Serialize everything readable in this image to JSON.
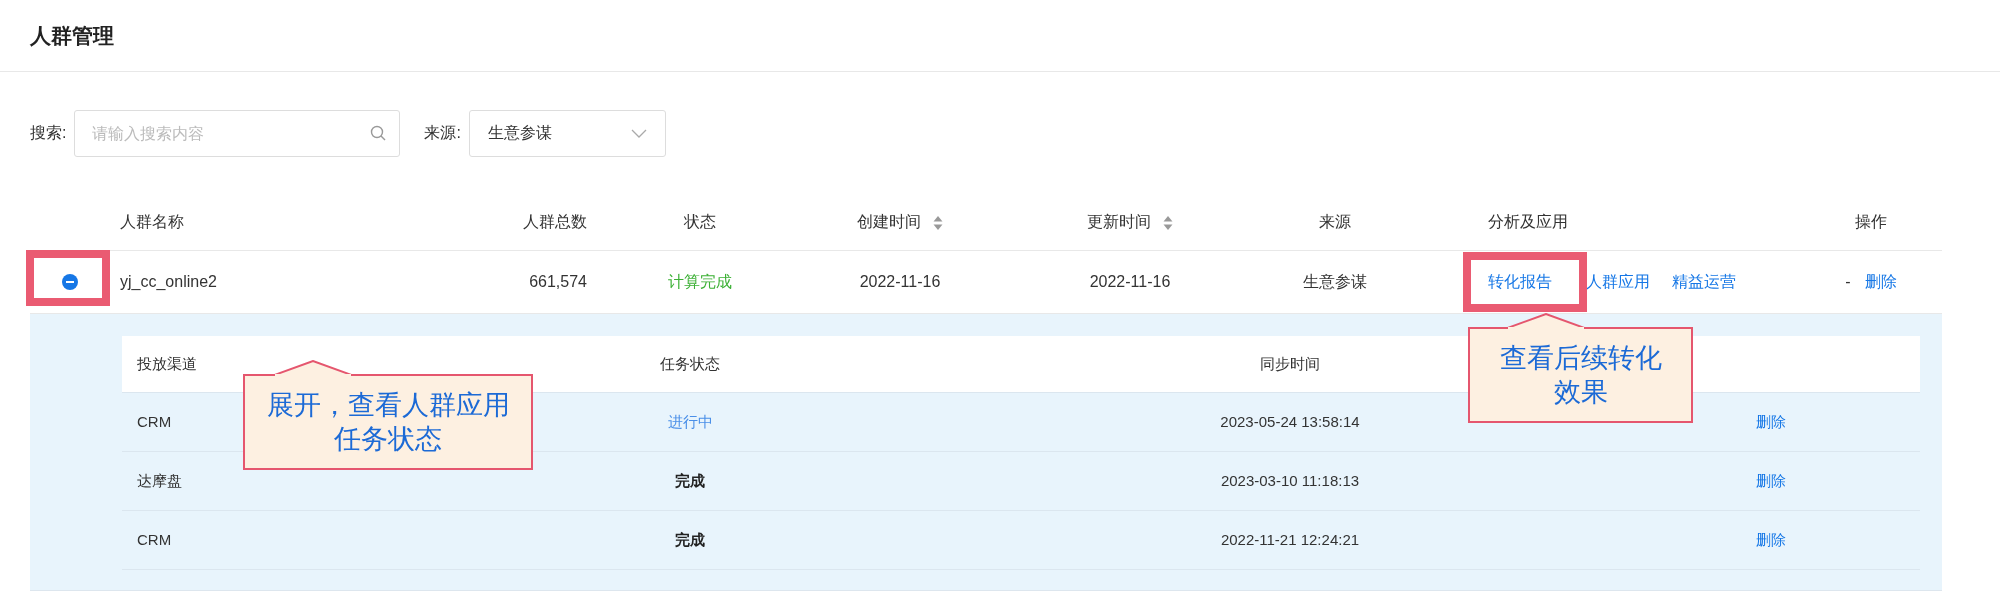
{
  "page": {
    "title": "人群管理"
  },
  "filters": {
    "search_label": "搜索:",
    "search_placeholder": "请输入搜索内容",
    "source_label": "来源:",
    "source_value": "生意参谋"
  },
  "table": {
    "columns": [
      {
        "label": "人群名称",
        "sortable": false
      },
      {
        "label": "人群总数",
        "sortable": false
      },
      {
        "label": "状态",
        "sortable": false
      },
      {
        "label": "创建时间",
        "sortable": true
      },
      {
        "label": "更新时间",
        "sortable": true
      },
      {
        "label": "来源",
        "sortable": false
      },
      {
        "label": "分析及应用",
        "sortable": false
      },
      {
        "label": "操作",
        "sortable": false
      }
    ],
    "rows": [
      {
        "expanded": true,
        "name": "yj_cc_online2",
        "total": "661,574",
        "status": "计算完成",
        "created": "2022-11-16",
        "updated": "2022-11-16",
        "source": "生意参谋",
        "analysis_links": [
          "转化报告",
          "人群应用",
          "精益运营"
        ],
        "op_dash": "-",
        "op_delete": "删除",
        "tasks": {
          "columns": [
            "投放渠道",
            "任务状态",
            "同步时间"
          ],
          "rows": [
            {
              "channel": "CRM",
              "status": "进行中",
              "kind": "running",
              "sync_time": "2023-05-24 13:58:14",
              "action": "删除"
            },
            {
              "channel": "达摩盘",
              "status": "完成",
              "kind": "done",
              "sync_time": "2023-03-10 11:18:13",
              "action": "删除"
            },
            {
              "channel": "CRM",
              "status": "完成",
              "kind": "done",
              "sync_time": "2022-11-21 12:24:21",
              "action": "删除"
            }
          ]
        }
      }
    ]
  },
  "callouts": [
    {
      "text": "展开，查看人群应用任务状态"
    },
    {
      "text": "查看后续转化效果"
    }
  ]
}
